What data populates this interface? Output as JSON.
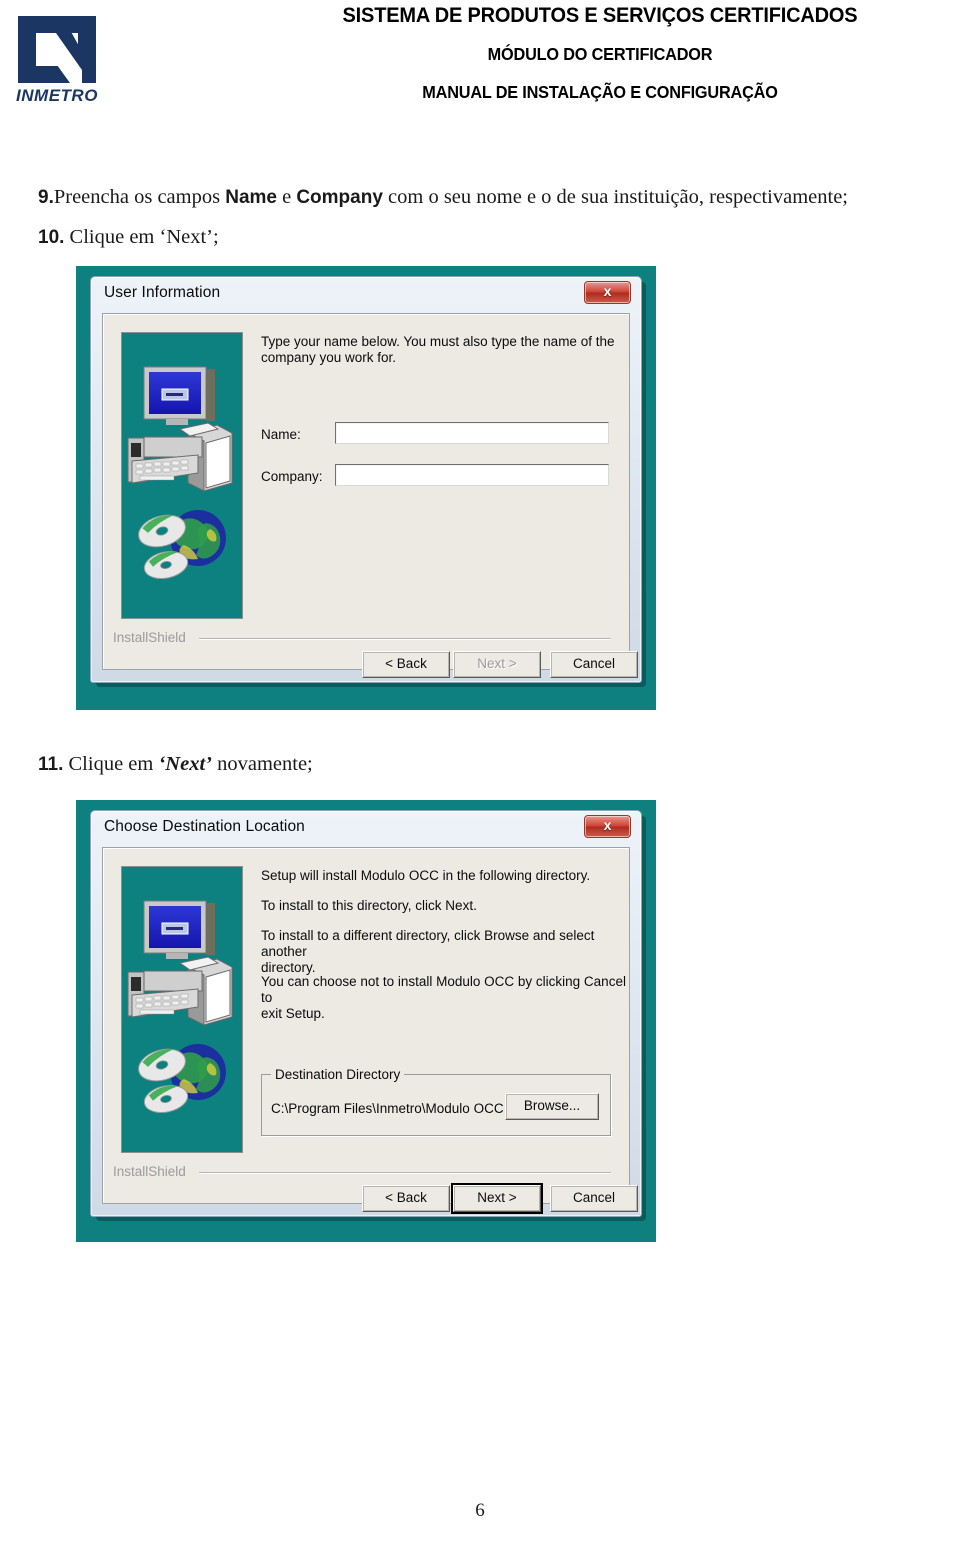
{
  "header": {
    "logo_alt": "INMETRO",
    "logo_text": "INMETRO",
    "line1": "SISTEMA DE PRODUTOS E SERVIÇOS CERTIFICADOS",
    "line2": "MÓDULO DO CERTIFICADOR",
    "line3": "MANUAL DE INSTALAÇÃO E CONFIGURAÇÃO",
    "logo_color": "#1c3663"
  },
  "steps": {
    "step9": {
      "number": "9.",
      "part1": "Preencha os campos ",
      "bold1": "Name",
      "part2": " e ",
      "bold2": "Company",
      "part3": " com o seu nome e o de sua instituição, respectivamente;"
    },
    "step10": {
      "number": "10.",
      "part1": " Clique em ‘Next’;"
    },
    "step11": {
      "number": "11.",
      "part1": " Clique em ",
      "bold1": "‘Next’",
      "part2": " novamente;"
    }
  },
  "dialog1": {
    "title": "User Information",
    "close_label": "x",
    "body_line1": "Type your name below. You must also type the name of the",
    "body_line2": "company you work for.",
    "name_label": "Name:",
    "name_value": "",
    "company_label": "Company:",
    "company_value": "",
    "brand": "InstallShield",
    "buttons": {
      "back": "< Back",
      "next": "Next >",
      "cancel": "Cancel"
    }
  },
  "dialog2": {
    "title": "Choose Destination Location",
    "close_label": "x",
    "body_line1": "Setup will install Modulo OCC in the following directory.",
    "body_line2": "To install to this directory, click Next.",
    "body_line3": "To install to a different directory, click Browse and select another",
    "body_line4": "directory.",
    "body_line5": "You can choose not to install Modulo OCC by clicking Cancel to",
    "body_line6": "exit Setup.",
    "group_title": "Destination Directory",
    "path": "C:\\Program Files\\Inmetro\\Modulo OCC",
    "browse": "Browse...",
    "brand": "InstallShield",
    "buttons": {
      "back": "< Back",
      "next": "Next >",
      "cancel": "Cancel"
    }
  },
  "footer": {
    "page_number": "6"
  },
  "colors": {
    "teal_background": "#0e8080",
    "logo_navy": "#1c3663",
    "close_red": "#c9382c",
    "dialog_grey": "#eceae3"
  }
}
